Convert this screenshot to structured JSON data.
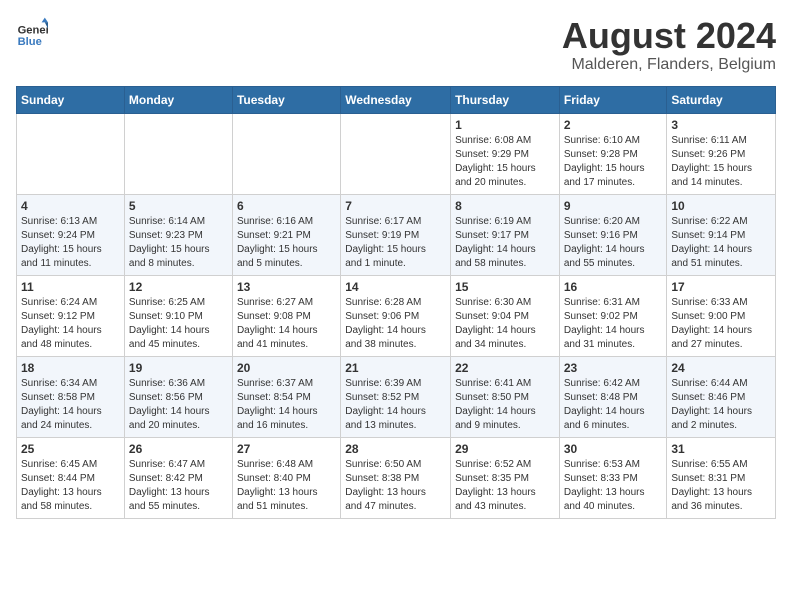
{
  "logo": {
    "line1": "General",
    "line2": "Blue"
  },
  "title": {
    "month_year": "August 2024",
    "location": "Malderen, Flanders, Belgium"
  },
  "days_of_week": [
    "Sunday",
    "Monday",
    "Tuesday",
    "Wednesday",
    "Thursday",
    "Friday",
    "Saturday"
  ],
  "weeks": [
    [
      {
        "day": "",
        "info": ""
      },
      {
        "day": "",
        "info": ""
      },
      {
        "day": "",
        "info": ""
      },
      {
        "day": "",
        "info": ""
      },
      {
        "day": "1",
        "info": "Sunrise: 6:08 AM\nSunset: 9:29 PM\nDaylight: 15 hours\nand 20 minutes."
      },
      {
        "day": "2",
        "info": "Sunrise: 6:10 AM\nSunset: 9:28 PM\nDaylight: 15 hours\nand 17 minutes."
      },
      {
        "day": "3",
        "info": "Sunrise: 6:11 AM\nSunset: 9:26 PM\nDaylight: 15 hours\nand 14 minutes."
      }
    ],
    [
      {
        "day": "4",
        "info": "Sunrise: 6:13 AM\nSunset: 9:24 PM\nDaylight: 15 hours\nand 11 minutes."
      },
      {
        "day": "5",
        "info": "Sunrise: 6:14 AM\nSunset: 9:23 PM\nDaylight: 15 hours\nand 8 minutes."
      },
      {
        "day": "6",
        "info": "Sunrise: 6:16 AM\nSunset: 9:21 PM\nDaylight: 15 hours\nand 5 minutes."
      },
      {
        "day": "7",
        "info": "Sunrise: 6:17 AM\nSunset: 9:19 PM\nDaylight: 15 hours\nand 1 minute."
      },
      {
        "day": "8",
        "info": "Sunrise: 6:19 AM\nSunset: 9:17 PM\nDaylight: 14 hours\nand 58 minutes."
      },
      {
        "day": "9",
        "info": "Sunrise: 6:20 AM\nSunset: 9:16 PM\nDaylight: 14 hours\nand 55 minutes."
      },
      {
        "day": "10",
        "info": "Sunrise: 6:22 AM\nSunset: 9:14 PM\nDaylight: 14 hours\nand 51 minutes."
      }
    ],
    [
      {
        "day": "11",
        "info": "Sunrise: 6:24 AM\nSunset: 9:12 PM\nDaylight: 14 hours\nand 48 minutes."
      },
      {
        "day": "12",
        "info": "Sunrise: 6:25 AM\nSunset: 9:10 PM\nDaylight: 14 hours\nand 45 minutes."
      },
      {
        "day": "13",
        "info": "Sunrise: 6:27 AM\nSunset: 9:08 PM\nDaylight: 14 hours\nand 41 minutes."
      },
      {
        "day": "14",
        "info": "Sunrise: 6:28 AM\nSunset: 9:06 PM\nDaylight: 14 hours\nand 38 minutes."
      },
      {
        "day": "15",
        "info": "Sunrise: 6:30 AM\nSunset: 9:04 PM\nDaylight: 14 hours\nand 34 minutes."
      },
      {
        "day": "16",
        "info": "Sunrise: 6:31 AM\nSunset: 9:02 PM\nDaylight: 14 hours\nand 31 minutes."
      },
      {
        "day": "17",
        "info": "Sunrise: 6:33 AM\nSunset: 9:00 PM\nDaylight: 14 hours\nand 27 minutes."
      }
    ],
    [
      {
        "day": "18",
        "info": "Sunrise: 6:34 AM\nSunset: 8:58 PM\nDaylight: 14 hours\nand 24 minutes."
      },
      {
        "day": "19",
        "info": "Sunrise: 6:36 AM\nSunset: 8:56 PM\nDaylight: 14 hours\nand 20 minutes."
      },
      {
        "day": "20",
        "info": "Sunrise: 6:37 AM\nSunset: 8:54 PM\nDaylight: 14 hours\nand 16 minutes."
      },
      {
        "day": "21",
        "info": "Sunrise: 6:39 AM\nSunset: 8:52 PM\nDaylight: 14 hours\nand 13 minutes."
      },
      {
        "day": "22",
        "info": "Sunrise: 6:41 AM\nSunset: 8:50 PM\nDaylight: 14 hours\nand 9 minutes."
      },
      {
        "day": "23",
        "info": "Sunrise: 6:42 AM\nSunset: 8:48 PM\nDaylight: 14 hours\nand 6 minutes."
      },
      {
        "day": "24",
        "info": "Sunrise: 6:44 AM\nSunset: 8:46 PM\nDaylight: 14 hours\nand 2 minutes."
      }
    ],
    [
      {
        "day": "25",
        "info": "Sunrise: 6:45 AM\nSunset: 8:44 PM\nDaylight: 13 hours\nand 58 minutes."
      },
      {
        "day": "26",
        "info": "Sunrise: 6:47 AM\nSunset: 8:42 PM\nDaylight: 13 hours\nand 55 minutes."
      },
      {
        "day": "27",
        "info": "Sunrise: 6:48 AM\nSunset: 8:40 PM\nDaylight: 13 hours\nand 51 minutes."
      },
      {
        "day": "28",
        "info": "Sunrise: 6:50 AM\nSunset: 8:38 PM\nDaylight: 13 hours\nand 47 minutes."
      },
      {
        "day": "29",
        "info": "Sunrise: 6:52 AM\nSunset: 8:35 PM\nDaylight: 13 hours\nand 43 minutes."
      },
      {
        "day": "30",
        "info": "Sunrise: 6:53 AM\nSunset: 8:33 PM\nDaylight: 13 hours\nand 40 minutes."
      },
      {
        "day": "31",
        "info": "Sunrise: 6:55 AM\nSunset: 8:31 PM\nDaylight: 13 hours\nand 36 minutes."
      }
    ]
  ]
}
